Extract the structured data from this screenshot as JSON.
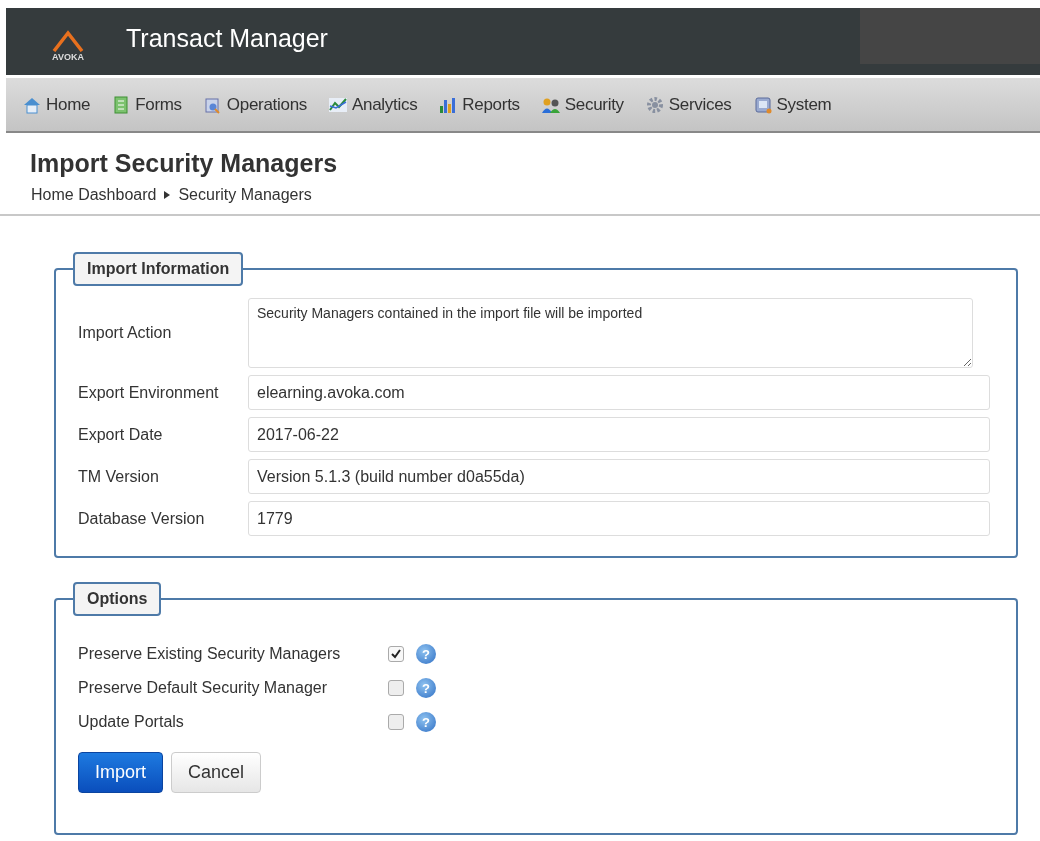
{
  "header": {
    "logo_text": "AVOKA",
    "title": "Transact Manager"
  },
  "nav": [
    {
      "label": "Home"
    },
    {
      "label": "Forms"
    },
    {
      "label": "Operations"
    },
    {
      "label": "Analytics"
    },
    {
      "label": "Reports"
    },
    {
      "label": "Security"
    },
    {
      "label": "Services"
    },
    {
      "label": "System"
    }
  ],
  "page": {
    "title": "Import Security Managers",
    "breadcrumb": [
      "Home Dashboard",
      "Security Managers"
    ]
  },
  "import_information": {
    "legend": "Import Information",
    "fields": [
      {
        "kind": "textarea",
        "label": "Import Action",
        "value": "Security Managers contained in the import file will be imported"
      },
      {
        "kind": "input",
        "label": "Export Environment",
        "value": "elearning.avoka.com"
      },
      {
        "kind": "input",
        "label": "Export Date",
        "value": "2017-06-22"
      },
      {
        "kind": "input",
        "label": "TM Version",
        "value": "Version 5.1.3 (build number d0a55da)"
      },
      {
        "kind": "input",
        "label": "Database Version",
        "value": "1779"
      }
    ]
  },
  "options": {
    "legend": "Options",
    "items": [
      {
        "label": "Preserve Existing Security Managers",
        "checked": true
      },
      {
        "label": "Preserve Default Security Manager",
        "checked": false
      },
      {
        "label": "Update Portals",
        "checked": false
      }
    ],
    "help_text": "?",
    "buttons": [
      {
        "label": "Import",
        "kind": "primary"
      },
      {
        "label": "Cancel",
        "kind": "secondary"
      }
    ]
  }
}
